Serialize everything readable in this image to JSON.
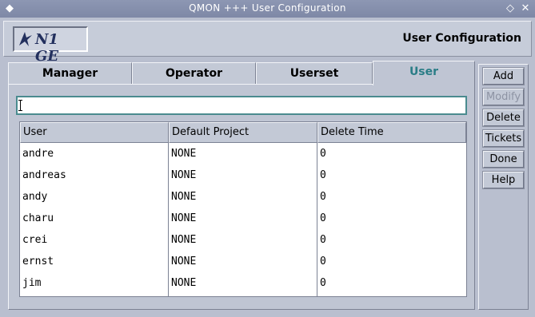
{
  "window": {
    "title": "QMON  +++  User Configuration"
  },
  "header": {
    "logo_text": "N1 GE",
    "title": "User Configuration"
  },
  "tabs": [
    {
      "label": "Manager",
      "active": false
    },
    {
      "label": "Operator",
      "active": false
    },
    {
      "label": "Userset",
      "active": false
    },
    {
      "label": "User",
      "active": true
    }
  ],
  "input": {
    "value": ""
  },
  "table": {
    "columns": [
      "User",
      "Default Project",
      "Delete Time"
    ],
    "rows": [
      [
        "andre",
        "NONE",
        "0"
      ],
      [
        "andreas",
        "NONE",
        "0"
      ],
      [
        "andy",
        "NONE",
        "0"
      ],
      [
        "charu",
        "NONE",
        "0"
      ],
      [
        "crei",
        "NONE",
        "0"
      ],
      [
        "ernst",
        "NONE",
        "0"
      ],
      [
        "jim",
        "NONE",
        "0"
      ]
    ]
  },
  "buttons": [
    {
      "label": "Add",
      "enabled": true
    },
    {
      "label": "Modify",
      "enabled": false
    },
    {
      "label": "Delete",
      "enabled": true
    },
    {
      "label": "Tickets",
      "enabled": true
    },
    {
      "label": "Done",
      "enabled": true
    },
    {
      "label": "Help",
      "enabled": true
    }
  ],
  "colors": {
    "active_tab": "#2a7d86",
    "focus_border": "#4a8b8f"
  },
  "icons": {
    "window_menu": "diamond-icon",
    "minimize": "minimize-icon",
    "close": "close-icon"
  }
}
